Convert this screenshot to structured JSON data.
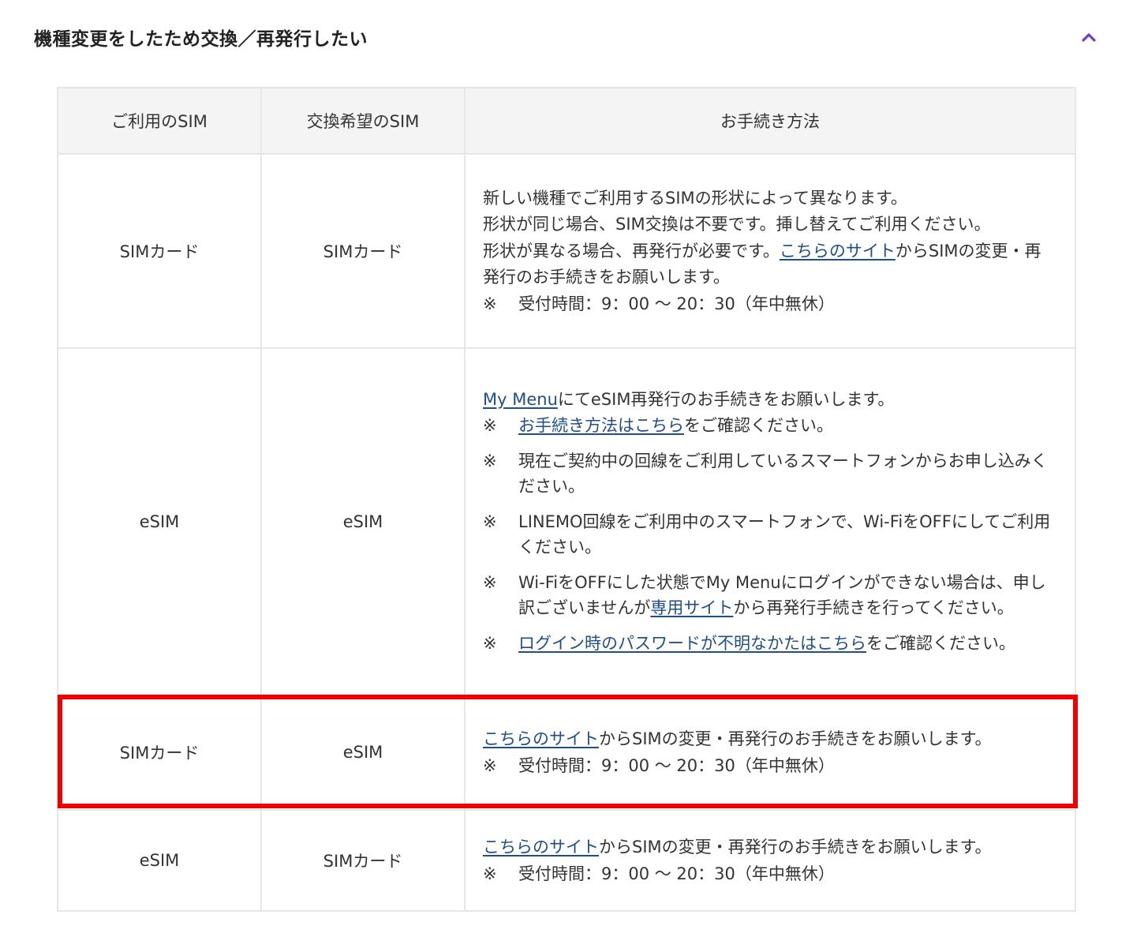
{
  "accordion": {
    "title": "機種変更をしたため交換／再発行したい",
    "chevron_color": "#6b3fd4"
  },
  "table": {
    "headers": [
      "ご利用のSIM",
      "交換希望のSIM",
      "お手続き方法"
    ],
    "rows": [
      {
        "current": "SIMカード",
        "desired": "SIMカード",
        "line1": "新しい機種でご利用するSIMの形状によって異なります。",
        "line2": "形状が同じ場合、SIM交換は不要です。挿し替えてご利用ください。",
        "line3_pre": "形状が異なる場合、再発行が必要です。",
        "line3_link": "こちらのサイト",
        "line3_post": "からSIMの変更・再発行のお手続きをお願いします。",
        "note_mark": "※",
        "note": "受付時間：9：00 〜 20：30（年中無休）"
      },
      {
        "current": "eSIM",
        "desired": "eSIM",
        "lead_link": "My Menu",
        "lead_post": "にてeSIM再発行のお手続きをお願いします。",
        "note1_link": "お手続き方法はこちら",
        "note1_post": "をご確認ください。",
        "note2": "現在ご契約中の回線をご利用しているスマートフォンからお申し込みください。",
        "note3": "LINEMO回線をご利用中のスマートフォンで、Wi-FiをOFFにしてご利用ください。",
        "note4_pre": "Wi-FiをOFFにした状態でMy Menuにログインができない場合は、申し訳ございませんが",
        "note4_link": "専用サイト",
        "note4_post": "から再発行手続きを行ってください。",
        "note5_link": "ログイン時のパスワードが不明なかたはこちら",
        "note5_post": "をご確認ください。",
        "note_mark": "※"
      },
      {
        "current": "SIMカード",
        "desired": "eSIM",
        "link": "こちらのサイト",
        "text": "からSIMの変更・再発行のお手続きをお願いします。",
        "note_mark": "※",
        "note": "受付時間：9：00 〜 20：30（年中無休）",
        "highlight_color": "#ee0000"
      },
      {
        "current": "eSIM",
        "desired": "SIMカード",
        "link": "こちらのサイト",
        "text": "からSIMの変更・再発行のお手続きをお願いします。",
        "note_mark": "※",
        "note": "受付時間：9：00 〜 20：30（年中無休）"
      }
    ]
  }
}
